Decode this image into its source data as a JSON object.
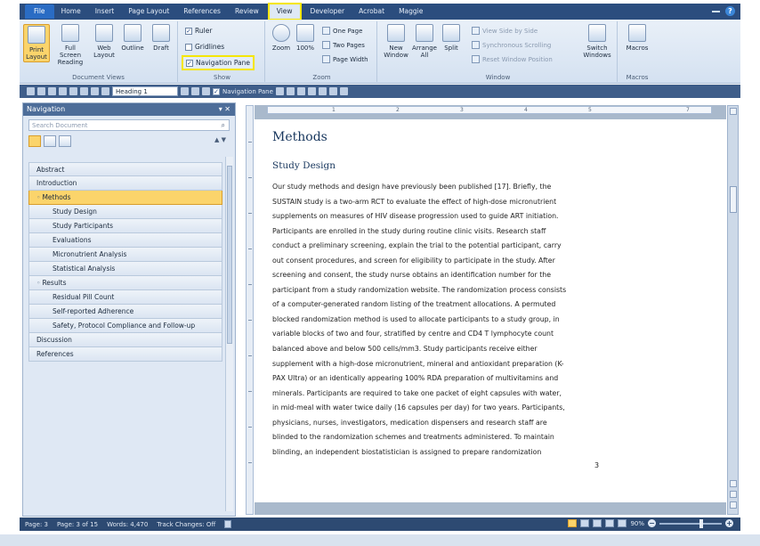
{
  "tabs": [
    "File",
    "Home",
    "Insert",
    "Page Layout",
    "References",
    "Review",
    "View",
    "Developer",
    "Acrobat",
    "Maggie"
  ],
  "active_tab": "View",
  "ribbon": {
    "document_views": {
      "label": "Document Views",
      "buttons": [
        "Print Layout",
        "Full Screen Reading",
        "Web Layout",
        "Outline",
        "Draft"
      ]
    },
    "show": {
      "label": "Show",
      "ruler": "Ruler",
      "gridlines": "Gridlines",
      "navigation_pane": "Navigation Pane",
      "check": "✓"
    },
    "zoom": {
      "label": "Zoom",
      "zoom_btn": "Zoom",
      "hundred_btn": "100%",
      "one_page": "One Page",
      "two_pages": "Two Pages",
      "page_width": "Page Width"
    },
    "window": {
      "label": "Window",
      "new_window": "New Window",
      "arrange_all": "Arrange All",
      "split": "Split",
      "view_side_by_side": "View Side by Side",
      "sync_scrolling": "Synchronous Scrolling",
      "reset_window": "Reset Window Position",
      "switch_windows": "Switch Windows"
    },
    "macros": {
      "label": "Macros",
      "macros_btn": "Macros"
    }
  },
  "toolbar": {
    "style_value": "Heading 1",
    "nav_pane_label": "Navigation Pane"
  },
  "nav": {
    "title": "Navigation",
    "search_placeholder": "Search Document",
    "items": [
      {
        "label": "Abstract"
      },
      {
        "label": "Introduction"
      },
      {
        "label": "Methods"
      },
      {
        "label": "Study Design"
      },
      {
        "label": "Study Participants"
      },
      {
        "label": "Evaluations"
      },
      {
        "label": "Micronutrient Analysis"
      },
      {
        "label": "Statistical Analysis"
      },
      {
        "label": "Results"
      },
      {
        "label": "Residual Pill Count"
      },
      {
        "label": "Self-reported Adherence"
      },
      {
        "label": "Safety, Protocol Compliance and Follow-up"
      },
      {
        "label": "Discussion"
      },
      {
        "label": "References"
      }
    ]
  },
  "ruler_numbers": [
    "1",
    "2",
    "3",
    "4",
    "5",
    "7"
  ],
  "document": {
    "title": "Methods",
    "subtitle": "Study Design",
    "lines": [
      "Our study methods and design have previously been published [17]. Briefly, the",
      "SUSTAIN study is a two-arm RCT to evaluate the effect of high-dose micronutrient",
      "supplements on measures of HIV disease progression used to guide ART initiation.",
      "Participants are enrolled in the study during routine clinic visits. Research staff",
      "conduct a preliminary screening, explain the trial to the potential participant, carry",
      "out consent procedures, and screen for eligibility to participate in the study. After",
      "screening and consent, the study nurse obtains an identification number for the",
      "participant from a study randomization website. The randomization process consists",
      "of a computer-generated random listing of the treatment allocations. A permuted",
      "blocked randomization method is used to allocate participants to a study group, in",
      "variable blocks of two and four, stratified by centre and CD4 T lymphocyte count",
      "balanced above and below 500 cells/mm3. Study participants receive either",
      "supplement with a high-dose micronutrient, mineral and antioxidant preparation (K-",
      "PAX Ultra) or an identically appearing 100% RDA preparation of multivitamins and",
      "minerals. Participants are required to take one packet of eight capsules with water,",
      "in mid-meal with water twice daily (16 capsules per day) for two years. Participants,",
      "physicians, nurses, investigators, medication dispensers and research staff are",
      "blinded to the randomization schemes and treatments administered. To maintain",
      "blinding, an independent biostatistician is assigned to prepare randomization"
    ],
    "page_number": "3"
  },
  "status": {
    "page": "Page: 3",
    "page_of": "Page: 3 of 15",
    "words": "Words: 4,470",
    "track_changes": "Track Changes: Off",
    "zoom": "90%"
  },
  "colors": {
    "accent_highlight": "#f5e600",
    "selected_fill": "#fbd46b",
    "title_bar": "#2b4d7e"
  }
}
